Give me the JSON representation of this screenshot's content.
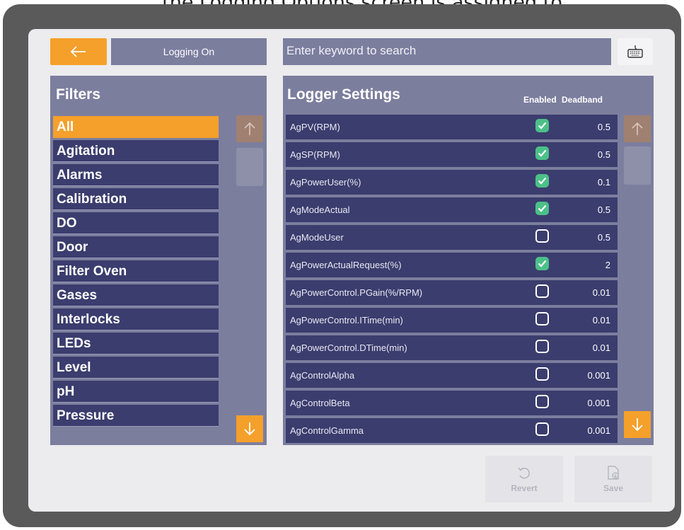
{
  "caption_fragment": ", the Logging Options screen is assigned to",
  "toolbar": {
    "back_icon": "arrow-left-icon",
    "logging_label": "Logging On",
    "search_placeholder": "Enter keyword to search",
    "keyboard_icon": "keyboard-icon"
  },
  "filters": {
    "title": "Filters",
    "items": [
      {
        "label": "All",
        "active": true
      },
      {
        "label": "Agitation"
      },
      {
        "label": "Alarms"
      },
      {
        "label": "Calibration"
      },
      {
        "label": "DO"
      },
      {
        "label": "Door"
      },
      {
        "label": "Filter Oven"
      },
      {
        "label": "Gases"
      },
      {
        "label": "Interlocks"
      },
      {
        "label": "LEDs"
      },
      {
        "label": "Level"
      },
      {
        "label": "pH"
      },
      {
        "label": "Pressure"
      }
    ]
  },
  "logger": {
    "title": "Logger Settings",
    "col_enabled": "Enabled",
    "col_deadband": "Deadband",
    "rows": [
      {
        "name": "AgPV(RPM)",
        "enabled": true,
        "deadband": "0.5"
      },
      {
        "name": "AgSP(RPM)",
        "enabled": true,
        "deadband": "0.5"
      },
      {
        "name": "AgPowerUser(%)",
        "enabled": true,
        "deadband": "0.1"
      },
      {
        "name": "AgModeActual",
        "enabled": true,
        "deadband": "0.5"
      },
      {
        "name": "AgModeUser",
        "enabled": false,
        "deadband": "0.5"
      },
      {
        "name": "AgPowerActualRequest(%)",
        "enabled": true,
        "deadband": "2"
      },
      {
        "name": "AgPowerControl.PGain(%/RPM)",
        "enabled": false,
        "deadband": "0.01"
      },
      {
        "name": "AgPowerControl.ITime(min)",
        "enabled": false,
        "deadband": "0.01"
      },
      {
        "name": "AgPowerControl.DTime(min)",
        "enabled": false,
        "deadband": "0.01"
      },
      {
        "name": "AgControlAlpha",
        "enabled": false,
        "deadband": "0.001"
      },
      {
        "name": "AgControlBeta",
        "enabled": false,
        "deadband": "0.001"
      },
      {
        "name": "AgControlGamma",
        "enabled": false,
        "deadband": "0.001"
      }
    ]
  },
  "actions": {
    "revert_label": "Revert",
    "save_label": "Save"
  },
  "colors": {
    "accent": "#f5a02b",
    "panel": "#7c7e9e",
    "row": "#3b3d6e",
    "check_on": "#4cc089"
  }
}
